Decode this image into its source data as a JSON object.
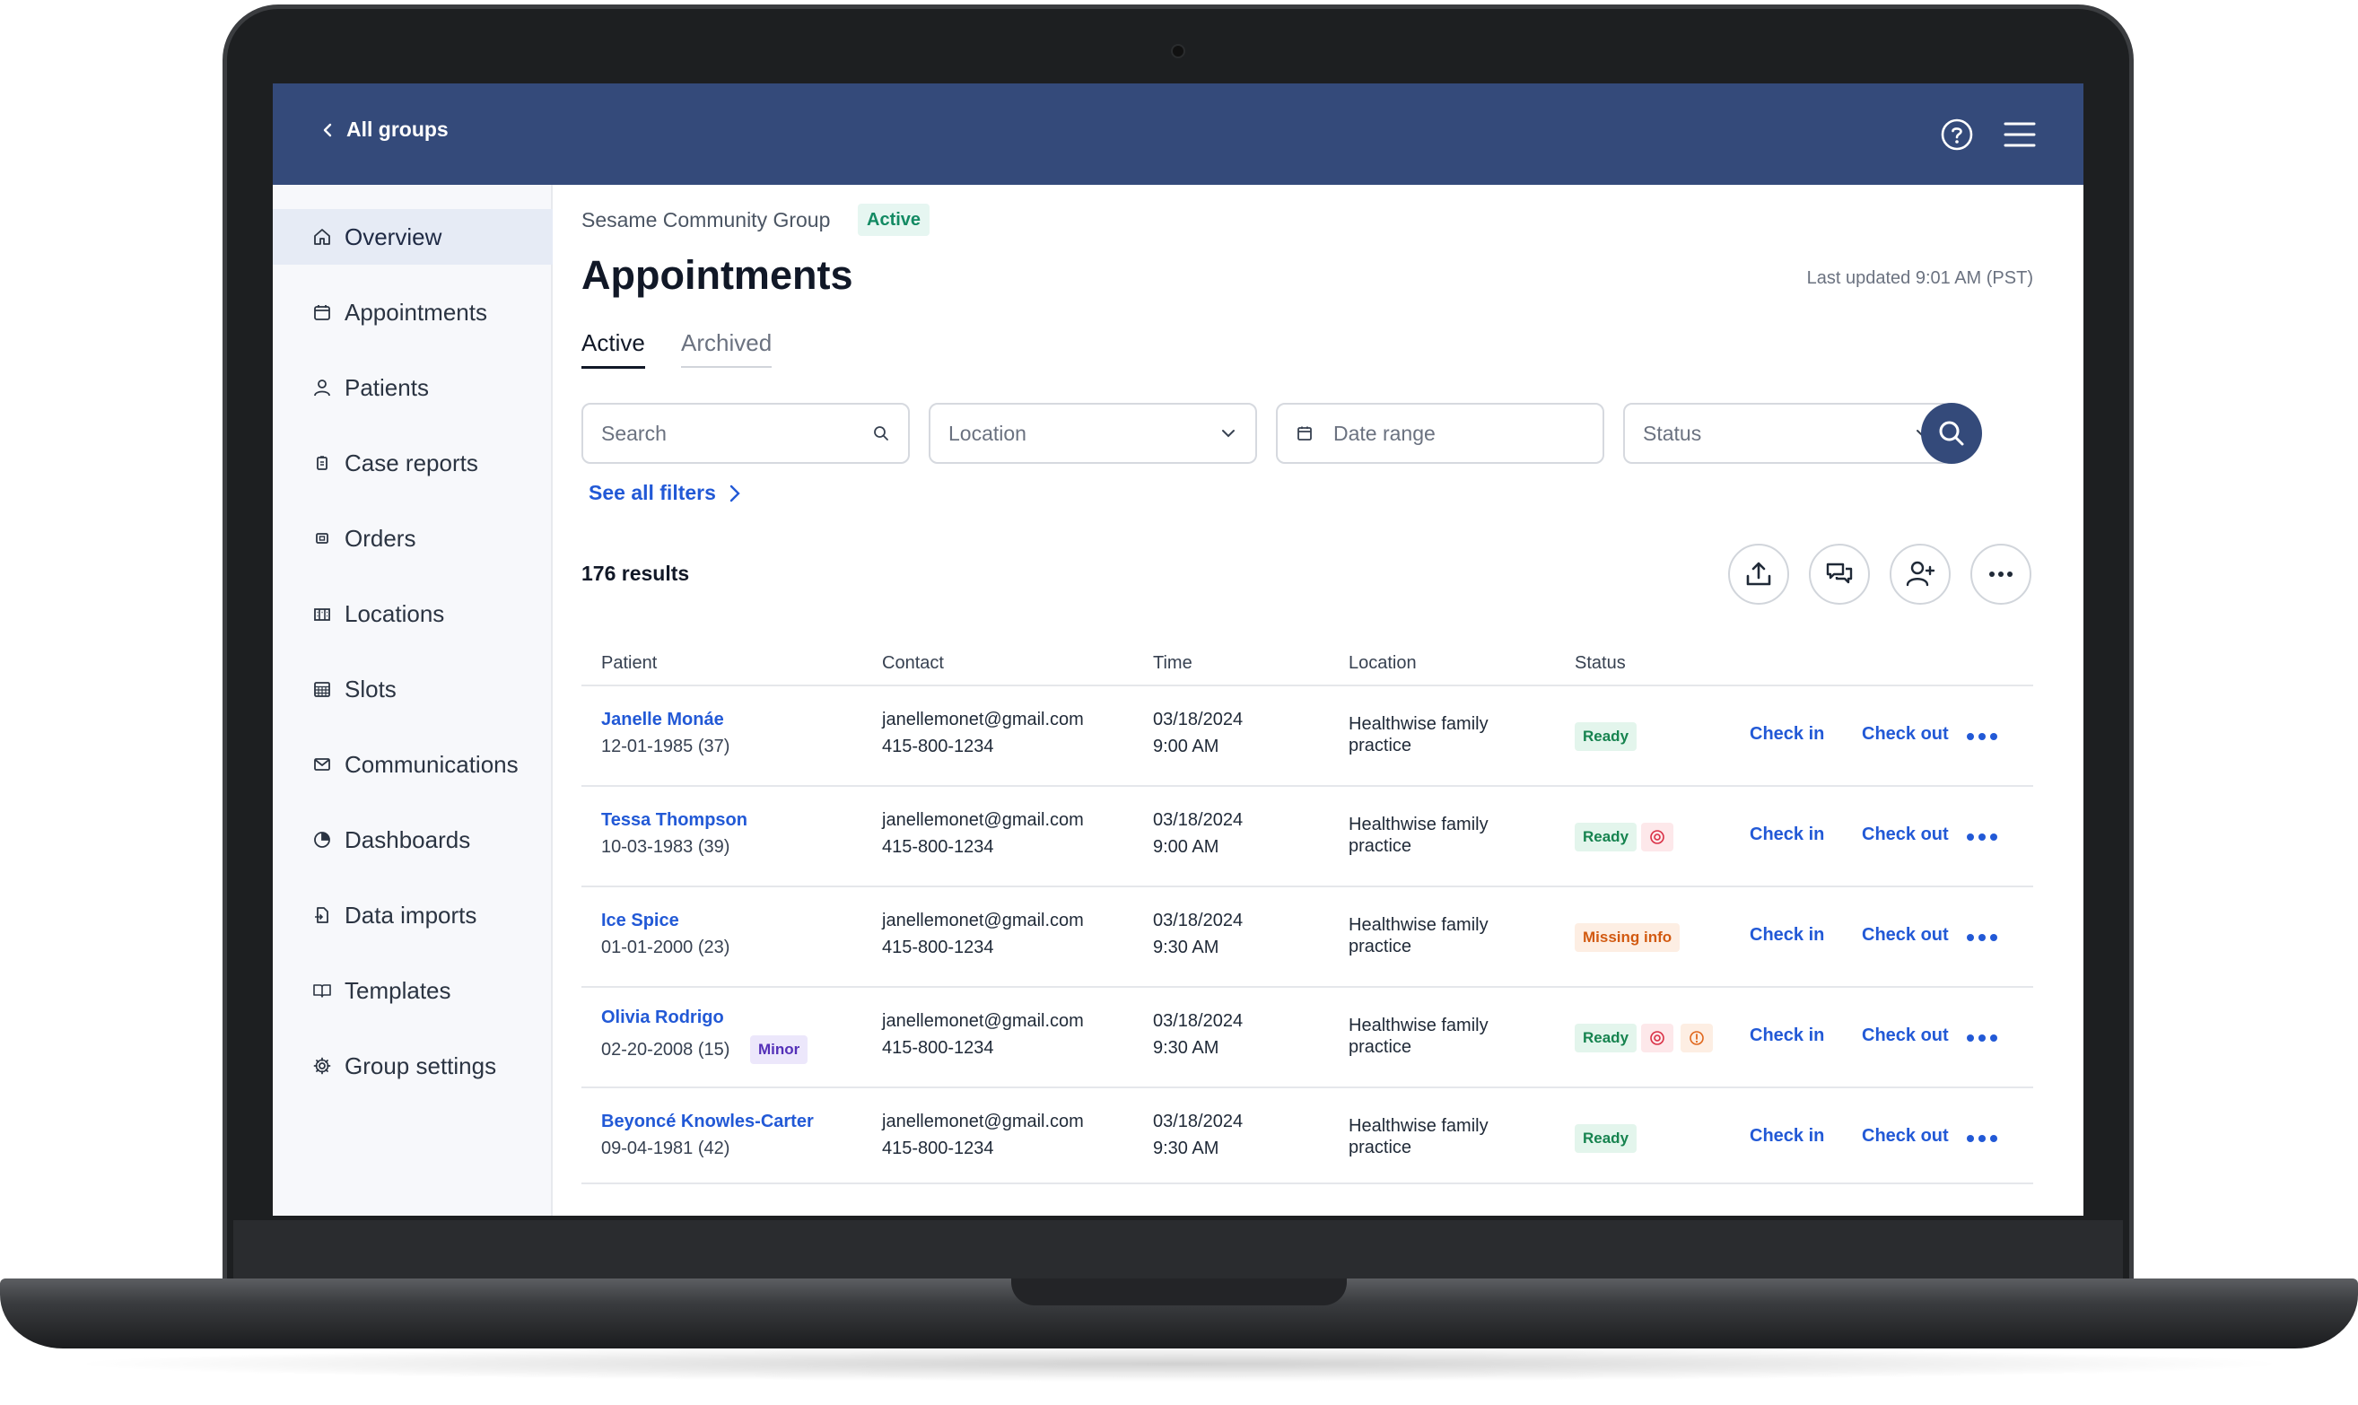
{
  "header": {
    "back_label": "All groups"
  },
  "sidebar": {
    "items": [
      {
        "label": "Overview",
        "icon": "home-icon"
      },
      {
        "label": "Appointments",
        "icon": "calendar-icon"
      },
      {
        "label": "Patients",
        "icon": "person-icon"
      },
      {
        "label": "Case reports",
        "icon": "clipboard-icon"
      },
      {
        "label": "Orders",
        "icon": "orders-icon"
      },
      {
        "label": "Locations",
        "icon": "building-icon"
      },
      {
        "label": "Slots",
        "icon": "grid-calendar-icon"
      },
      {
        "label": "Communications",
        "icon": "mail-icon"
      },
      {
        "label": "Dashboards",
        "icon": "pie-chart-icon"
      },
      {
        "label": "Data imports",
        "icon": "file-import-icon"
      },
      {
        "label": "Templates",
        "icon": "book-icon"
      },
      {
        "label": "Group settings",
        "icon": "gear-icon"
      }
    ],
    "active": "Overview"
  },
  "main": {
    "group_name": "Sesame Community Group",
    "group_status": "Active",
    "title": "Appointments",
    "last_updated": "Last updated 9:01 AM (PST)",
    "tabs": [
      {
        "label": "Active",
        "selected": true
      },
      {
        "label": "Archived",
        "selected": false
      }
    ],
    "filters": {
      "search_placeholder": "Search",
      "location_placeholder": "Location",
      "date_placeholder": "Date range",
      "status_placeholder": "Status",
      "see_all": "See all filters"
    },
    "results_count": "176 results",
    "toolbar_icons": [
      "upload-icon",
      "chat-icon",
      "add-person-icon",
      "more-icon"
    ],
    "table": {
      "headers": [
        "Patient",
        "Contact",
        "Time",
        "Location",
        "Status"
      ],
      "rows": [
        {
          "name": "Janelle Monáe",
          "dob": "12-01-1985 (37)",
          "email": "janellemonet@gmail.com",
          "phone": "415-800-1234",
          "date": "03/18/2024",
          "time": "9:00 AM",
          "loc1": "Healthwise family",
          "loc2": "practice",
          "status": "Ready",
          "check_in": "Check in",
          "check_out": "Check out"
        },
        {
          "name": "Tessa Thompson",
          "dob": "10-03-1983 (39)",
          "email": "janellemonet@gmail.com",
          "phone": "415-800-1234",
          "date": "03/18/2024",
          "time": "9:00 AM",
          "loc1": "Healthwise family",
          "loc2": "practice",
          "status": "Ready",
          "check_in": "Check in",
          "check_out": "Check out"
        },
        {
          "name": "Ice Spice",
          "dob": "01-01-2000 (23)",
          "email": "janellemonet@gmail.com",
          "phone": "415-800-1234",
          "date": "03/18/2024",
          "time": "9:30 AM",
          "loc1": "Healthwise family",
          "loc2": "practice",
          "status": "Missing info",
          "check_in": "Check in",
          "check_out": "Check out"
        },
        {
          "name": "Olivia Rodrigo",
          "dob": "02-20-2008 (15)",
          "tag": "Minor",
          "email": "janellemonet@gmail.com",
          "phone": "415-800-1234",
          "date": "03/18/2024",
          "time": "9:30 AM",
          "loc1": "Healthwise family",
          "loc2": "practice",
          "status": "Ready",
          "check_in": "Check in",
          "check_out": "Check out"
        },
        {
          "name": "Beyoncé Knowles-Carter",
          "dob": "09-04-1981 (42)",
          "email": "janellemonet@gmail.com",
          "phone": "415-800-1234",
          "date": "03/18/2024",
          "time": "9:30 AM",
          "loc1": "Healthwise family",
          "loc2": "practice",
          "status": "Ready",
          "check_in": "Check in",
          "check_out": "Check out"
        }
      ]
    }
  },
  "colors": {
    "header": "#344a7a",
    "link": "#2259d6",
    "ready": "#16834f",
    "missing": "#d25a11",
    "minor": "#5430b8"
  }
}
